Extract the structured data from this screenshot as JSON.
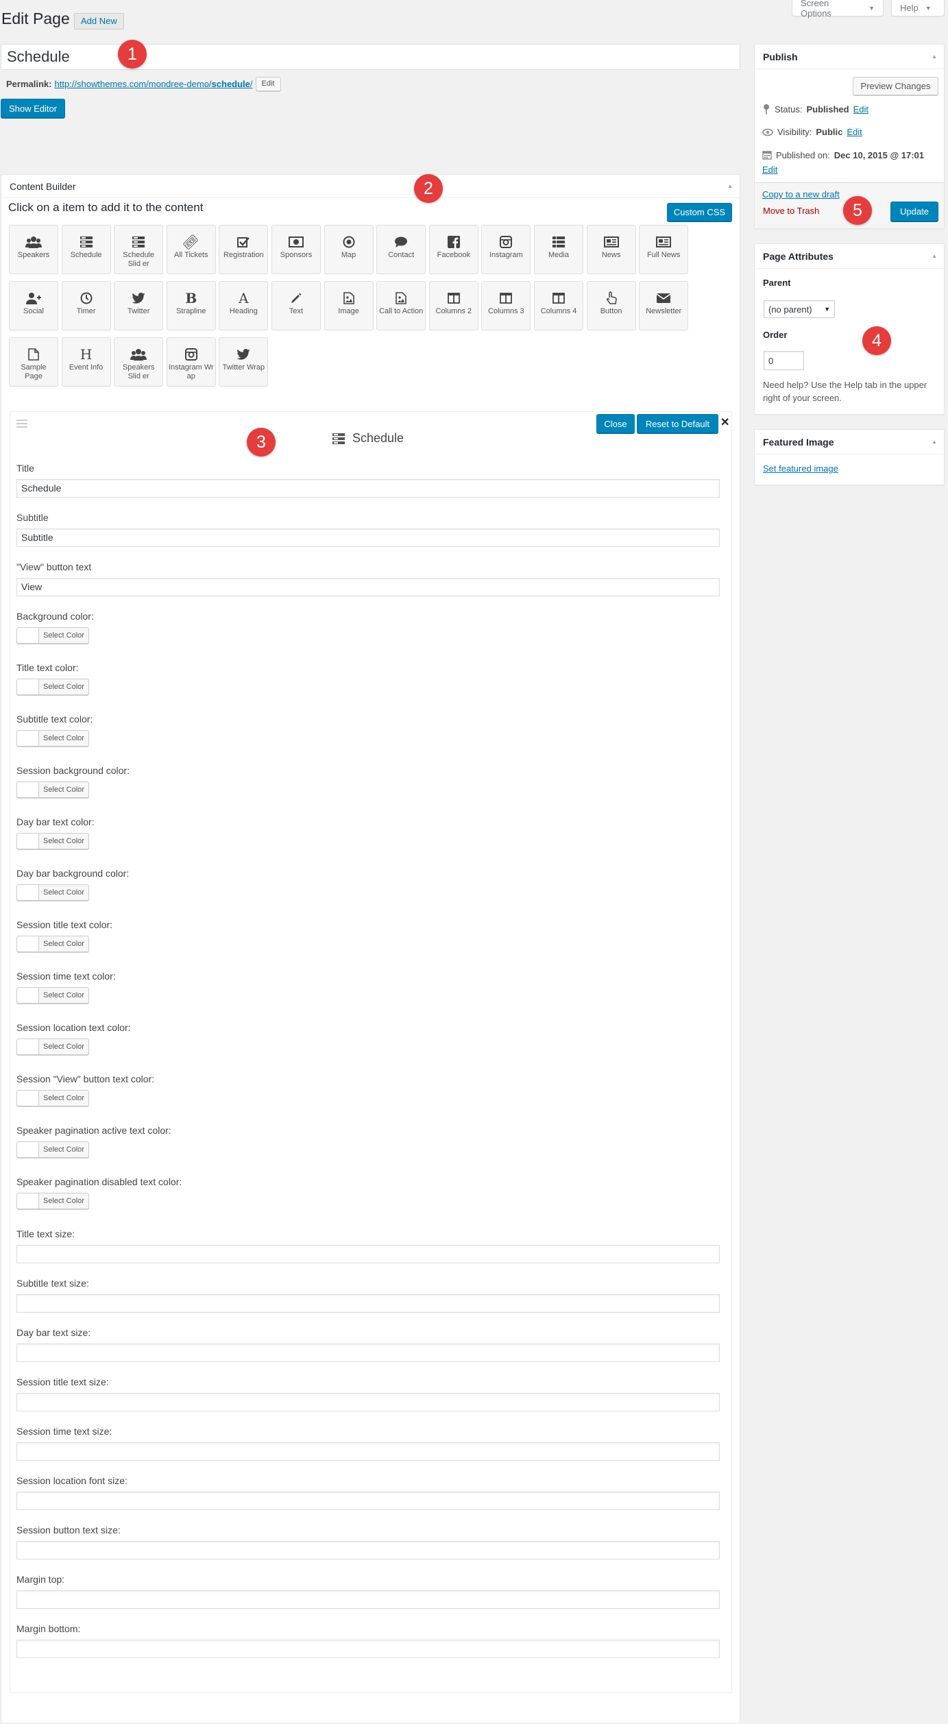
{
  "top": {
    "screen_options": "Screen Options",
    "help": "Help"
  },
  "header": {
    "title": "Edit Page",
    "add_new": "Add New"
  },
  "post_title": "Schedule",
  "permalink": {
    "label": "Permalink:",
    "url_prefix": "http://showthemes.com/mondree-demo/",
    "slug": "schedule",
    "url_suffix": "/",
    "edit": "Edit"
  },
  "show_editor": "Show Editor",
  "markers": [
    "1",
    "2",
    "3",
    "4",
    "5"
  ],
  "content_builder": {
    "title": "Content Builder",
    "intro": "Click on a item to add it to the content",
    "custom_css": "Custom CSS",
    "items": [
      {
        "label": "Speakers",
        "icon": "users-icon"
      },
      {
        "label": "Schedule",
        "icon": "schedule-icon"
      },
      {
        "label": "Schedule Slid er",
        "icon": "schedule-icon"
      },
      {
        "label": "All Tickets",
        "icon": "ticket-icon"
      },
      {
        "label": "Registration",
        "icon": "checkbox-icon"
      },
      {
        "label": "Sponsors",
        "icon": "money-icon"
      },
      {
        "label": "Map",
        "icon": "target-icon"
      },
      {
        "label": "Contact",
        "icon": "speech-bubble-icon"
      },
      {
        "label": "Facebook",
        "icon": "facebook-icon"
      },
      {
        "label": "Instagram",
        "icon": "instagram-icon"
      },
      {
        "label": "Media",
        "icon": "grid-list-icon"
      },
      {
        "label": "News",
        "icon": "newspaper-icon"
      },
      {
        "label": "Full News",
        "icon": "newspaper-icon"
      },
      {
        "label": "Social",
        "icon": "user-plus-icon"
      },
      {
        "label": "Timer",
        "icon": "clock-icon"
      },
      {
        "label": "Twitter",
        "icon": "twitter-icon"
      },
      {
        "label": "Strapline",
        "icon": "bold-icon"
      },
      {
        "label": "Heading",
        "icon": "font-icon"
      },
      {
        "label": "Text",
        "icon": "pencil-icon"
      },
      {
        "label": "Image",
        "icon": "image-file-icon"
      },
      {
        "label": "Call to Action",
        "icon": "image-file-icon"
      },
      {
        "label": "Columns 2",
        "icon": "columns-icon"
      },
      {
        "label": "Columns 3",
        "icon": "columns-icon"
      },
      {
        "label": "Columns 4",
        "icon": "columns-icon"
      },
      {
        "label": "Button",
        "icon": "hand-pointer-icon"
      },
      {
        "label": "Newsletter",
        "icon": "envelope-icon"
      },
      {
        "label": "Sample Page",
        "icon": "file-icon"
      },
      {
        "label": "Event Info",
        "icon": "header-icon"
      },
      {
        "label": "Speakers Slid er",
        "icon": "users-icon"
      },
      {
        "label": "Instagram Wr ap",
        "icon": "instagram-icon"
      },
      {
        "label": "Twitter Wrap",
        "icon": "twitter-icon"
      }
    ]
  },
  "element_panel": {
    "title": "Schedule",
    "close": "Close",
    "reset": "Reset to Default",
    "text_fields": [
      {
        "label": "Title",
        "value": "Schedule"
      },
      {
        "label": "Subtitle",
        "value": "Subtitle"
      },
      {
        "label": "\"View\" button text",
        "value": "View"
      }
    ],
    "select_color_label": "Select Color",
    "color_fields": [
      "Background color:",
      "Title text color:",
      "Subtitle text color:",
      "Session background color:",
      "Day bar text color:",
      "Day bar background color:",
      "Session title text color:",
      "Session time text color:",
      "Session location text color:",
      "Session \"View\" button text color:",
      "Speaker pagination active text color:",
      "Speaker pagination disabled text color:"
    ],
    "size_fields": [
      "Title text size:",
      "Subtitle text size:",
      "Day bar text size:",
      "Session title text size:",
      "Session time text size:",
      "Session location font size:",
      "Session button text size:",
      "Margin top:",
      "Margin bottom:"
    ]
  },
  "publish": {
    "title": "Publish",
    "preview": "Preview Changes",
    "status_label": "Status:",
    "status_value": "Published",
    "status_edit": "Edit",
    "visibility_label": "Visibility:",
    "visibility_value": "Public",
    "visibility_edit": "Edit",
    "published_label": "Published on:",
    "published_value": "Dec 10, 2015 @ 17:01",
    "published_edit": "Edit",
    "copy_draft": "Copy to a new draft",
    "trash": "Move to Trash",
    "update": "Update"
  },
  "page_attributes": {
    "title": "Page Attributes",
    "parent_label": "Parent",
    "parent_value": "(no parent)",
    "order_label": "Order",
    "order_value": "0",
    "help": "Need help? Use the Help tab in the upper right of your screen."
  },
  "featured_image": {
    "title": "Featured Image",
    "link": "Set featured image"
  }
}
